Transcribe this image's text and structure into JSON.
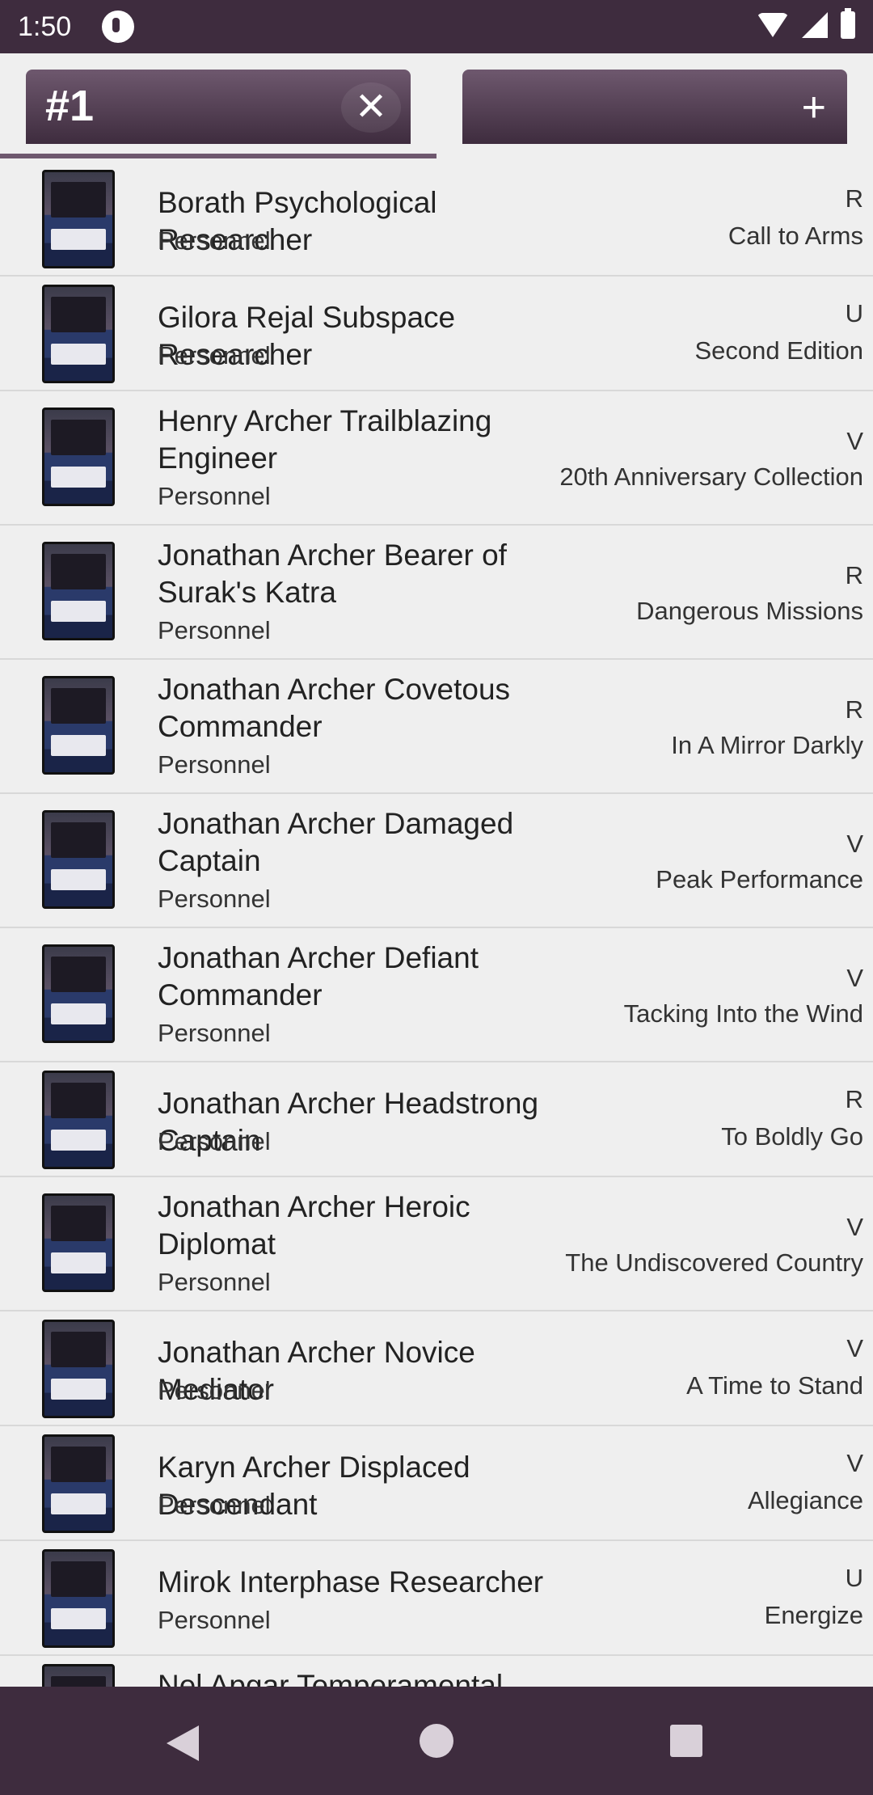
{
  "status_bar": {
    "time": "1:50"
  },
  "tabs": [
    {
      "label": "#1",
      "close_glyph": "✕"
    },
    {
      "label": "",
      "add_glyph": "+"
    }
  ],
  "cards": [
    {
      "name": "Borath Psychological Researcher",
      "type": "Personnel",
      "rarity": "R",
      "set": "Call to Arms"
    },
    {
      "name": "Gilora Rejal Subspace Researcher",
      "type": "Personnel",
      "rarity": "U",
      "set": "Second Edition"
    },
    {
      "name": "Henry Archer Trailblazing Engineer",
      "type": "Personnel",
      "rarity": "V",
      "set": "20th Anniversary Collection"
    },
    {
      "name": "Jonathan Archer Bearer of Surak's Katra",
      "type": "Personnel",
      "rarity": "R",
      "set": "Dangerous Missions"
    },
    {
      "name": "Jonathan Archer Covetous Commander",
      "type": "Personnel",
      "rarity": "R",
      "set": "In A Mirror Darkly"
    },
    {
      "name": "Jonathan Archer Damaged Captain",
      "type": "Personnel",
      "rarity": "V",
      "set": "Peak Performance"
    },
    {
      "name": "Jonathan Archer Defiant Commander",
      "type": "Personnel",
      "rarity": "V",
      "set": "Tacking Into the Wind"
    },
    {
      "name": "Jonathan Archer Headstrong Captain",
      "type": "Personnel",
      "rarity": "R",
      "set": "To Boldly Go"
    },
    {
      "name": "Jonathan Archer Heroic Diplomat",
      "type": "Personnel",
      "rarity": "V",
      "set": "The Undiscovered Country"
    },
    {
      "name": "Jonathan Archer Novice Mediator",
      "type": "Personnel",
      "rarity": "V",
      "set": "A Time to Stand"
    },
    {
      "name": "Karyn Archer Displaced Descendant",
      "type": "Personnel",
      "rarity": "V",
      "set": "Allegiance"
    },
    {
      "name": "Mirok Interphase Researcher",
      "type": "Personnel",
      "rarity": "U",
      "set": "Energize"
    },
    {
      "name": "Nel Apgar Temperamental",
      "type": "",
      "rarity": "",
      "set": ""
    }
  ],
  "colors": {
    "primary": "#3e2c3e",
    "tab_gradient_top": "#6e586e",
    "background": "#efefef"
  }
}
